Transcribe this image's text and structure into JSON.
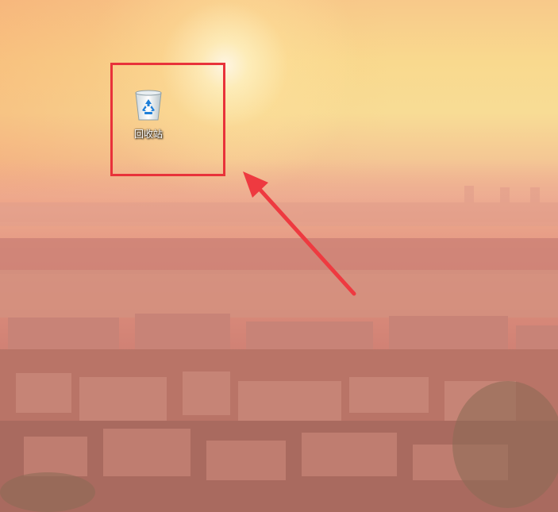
{
  "desktop": {
    "icons": [
      {
        "label": "回收站",
        "icon": "recycle-bin-icon"
      }
    ]
  },
  "annotation": {
    "highlight_color": "#e8323a",
    "arrow_color": "#ee3a40"
  },
  "wallpaper": {
    "description_colors": {
      "sky_top": "#f8c98a",
      "sky_mid": "#f8dc95",
      "city": "#c97a70"
    }
  }
}
